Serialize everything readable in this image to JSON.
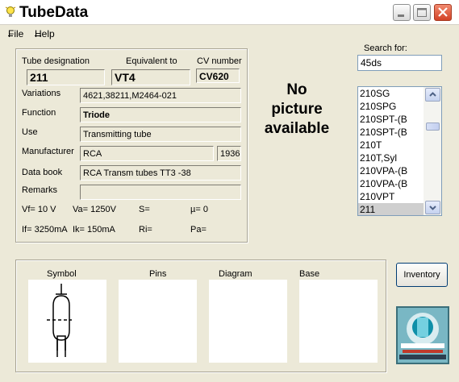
{
  "window": {
    "title": "TubeData",
    "icon": "lightbulb-icon",
    "controls": [
      "minimize-icon",
      "maximize-icon",
      "close-icon"
    ]
  },
  "menu": {
    "file": "File",
    "help": "Help"
  },
  "tube": {
    "designation_label": "Tube designation",
    "designation": "211",
    "equivalent_label": "Equivalent to",
    "equivalent": "VT4",
    "cv_label": "CV number",
    "cv": "CV620",
    "variations_label": "Variations",
    "variations": "4621,38211,M2464-021",
    "function_label": "Function",
    "function": "Triode",
    "use_label": "Use",
    "use": "Transmitting tube",
    "manufacturer_label": "Manufacturer",
    "manufacturer": "RCA",
    "year": "1936",
    "databook_label": "Data book",
    "databook": "RCA Transm tubes TT3 -38",
    "remarks_label": "Remarks",
    "remarks": ""
  },
  "params": {
    "vf": "Vf= 10 V",
    "va": "Va= 1250V",
    "s": "S=",
    "mu": "µ=   0",
    "if": "If= 3250mA",
    "ik": "Ik=  150mA",
    "ri": "Ri=",
    "pa": "Pa="
  },
  "picture": {
    "line1": "No",
    "line2": "picture",
    "line3": "available"
  },
  "search": {
    "label": "Search for:",
    "value": "45ds"
  },
  "list": {
    "items": [
      "210SG",
      "210SPG",
      "210SPT-(B",
      "210SPT-(B",
      "210T",
      "210T,Syl",
      "210VPA-(B",
      "210VPA-(B",
      "210VPT",
      "211"
    ],
    "selected_index": 9
  },
  "bottom": {
    "symbol": "Symbol",
    "pins": "Pins",
    "diagram": "Diagram",
    "base": "Base"
  },
  "inventory_button": "Inventory",
  "logo_icon": "tube-logo-icon"
}
